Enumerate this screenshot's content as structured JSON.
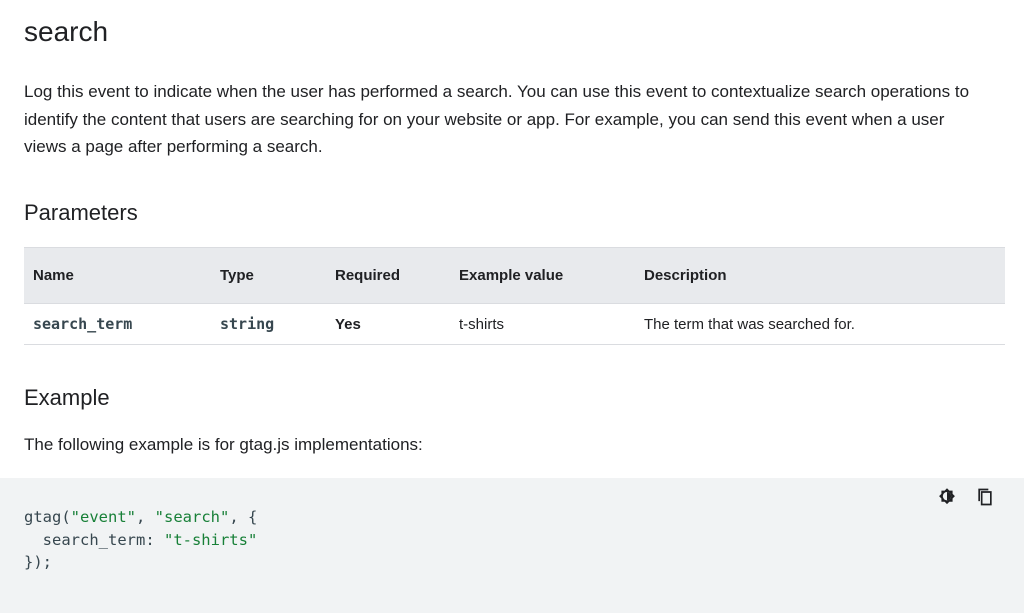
{
  "page": {
    "title": "search",
    "intro": "Log this event to indicate when the user has performed a search. You can use this event to contextualize search operations to identify the content that users are searching for on your website or app. For example, you can send this event when a user views a page after performing a search."
  },
  "parameters": {
    "heading": "Parameters",
    "columns": [
      "Name",
      "Type",
      "Required",
      "Example value",
      "Description"
    ],
    "rows": [
      {
        "name": "search_term",
        "type": "string",
        "required": "Yes",
        "example": "t-shirts",
        "description": "The term that was searched for."
      }
    ]
  },
  "example": {
    "heading": "Example",
    "text": "The following example is for gtag.js implementations:",
    "code": {
      "line1_fn": "gtag(",
      "line1_arg1": "\"event\"",
      "line1_sep": ", ",
      "line1_arg2": "\"search\"",
      "line1_end": ", {",
      "line2_key": "  search_term: ",
      "line2_val": "\"t-shirts\"",
      "line3": "});"
    },
    "actions": {
      "theme_icon": "dark-mode-toggle-icon",
      "copy_icon": "copy-icon"
    }
  },
  "colors": {
    "string_literal": "#188038",
    "table_header_bg": "#e8eaed",
    "code_bg": "#f1f3f4"
  }
}
